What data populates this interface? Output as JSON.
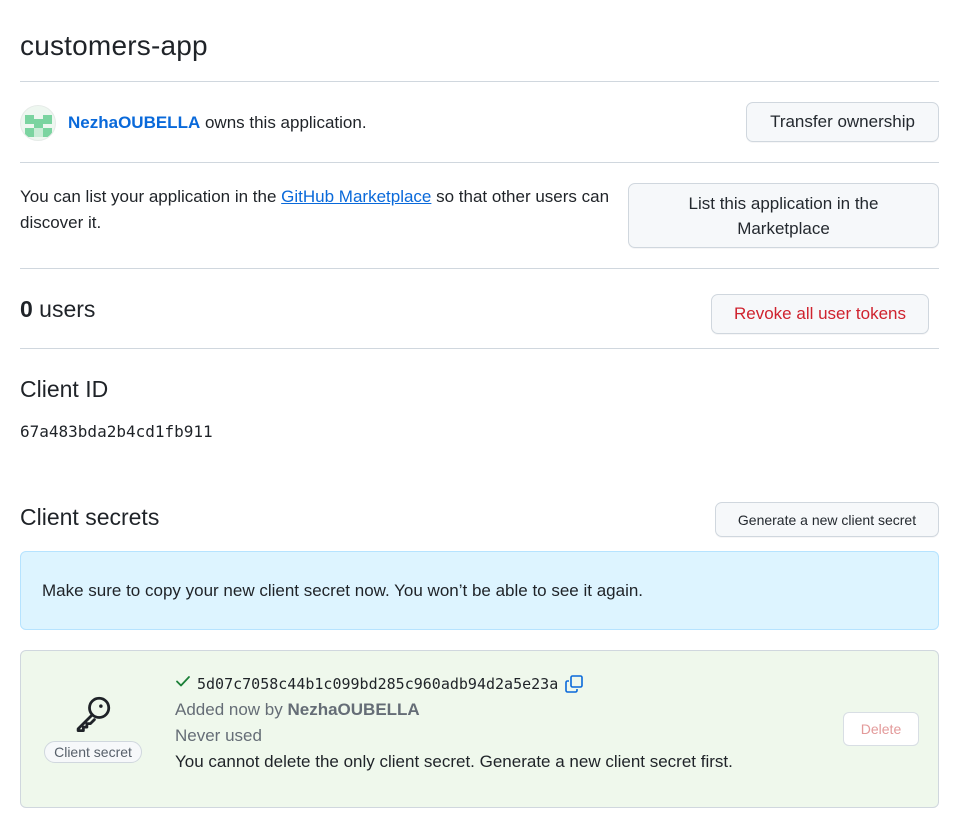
{
  "app": {
    "title": "customers-app"
  },
  "owner": {
    "username": "NezhaOUBELLA",
    "suffix": " owns this application.",
    "transfer_label": "Transfer ownership"
  },
  "marketplace": {
    "text_before": "You can list your application in the ",
    "link_text": "GitHub Marketplace",
    "text_after": " so that other users can discover it.",
    "button_label": "List this application in the Marketplace"
  },
  "users": {
    "count": "0",
    "label": " users",
    "revoke_label": "Revoke all user tokens",
    "revoke_color": "#cf222e"
  },
  "client_id": {
    "heading": "Client ID",
    "value": "67a483bda2b4cd1fb911"
  },
  "client_secrets": {
    "heading": "Client secrets",
    "generate_label": "Generate a new client secret",
    "flash_message": "Make sure to copy your new client secret now. You won’t be able to see it again.",
    "secret": {
      "icon": "key-icon",
      "label": "Client secret",
      "value": "5d07c7058c44b1c099bd285c960adb94d2a5e23a",
      "added_prefix": "Added now by ",
      "added_by": "NezhaOUBELLA",
      "usage": "Never used",
      "note": "You cannot delete the only client secret. Generate a new client secret first.",
      "delete_label": "Delete"
    }
  },
  "colors": {
    "link": "#0969da",
    "success": "#1a7f37",
    "flash_bg": "#ddf4ff",
    "secret_bg": "#eff8ec"
  }
}
